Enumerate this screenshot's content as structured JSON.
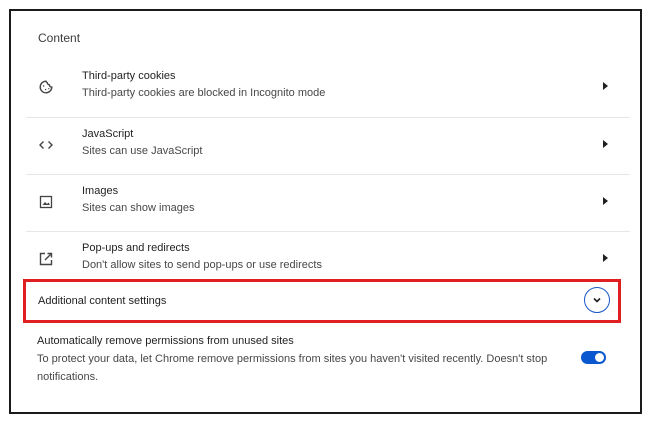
{
  "section": {
    "title": "Content"
  },
  "rows": [
    {
      "icon": "cookie-icon",
      "title": "Third-party cookies",
      "subtitle": "Third-party cookies are blocked in Incognito mode"
    },
    {
      "icon": "code-icon",
      "title": "JavaScript",
      "subtitle": "Sites can use JavaScript"
    },
    {
      "icon": "image-icon",
      "title": "Images",
      "subtitle": "Sites can show images"
    },
    {
      "icon": "open-in-new-icon",
      "title": "Pop-ups and redirects",
      "subtitle": "Don't allow sites to send pop-ups or use redirects"
    }
  ],
  "additional": {
    "label": "Additional content settings",
    "expand_icon": "chevron-down-icon"
  },
  "auto_remove": {
    "title": "Automatically remove permissions from unused sites",
    "description": "To protect your data, let Chrome remove permissions from sites you haven't visited recently. Doesn't stop notifications.",
    "enabled": true
  },
  "colors": {
    "accent": "#0b57d0",
    "highlight": "#e02020"
  }
}
